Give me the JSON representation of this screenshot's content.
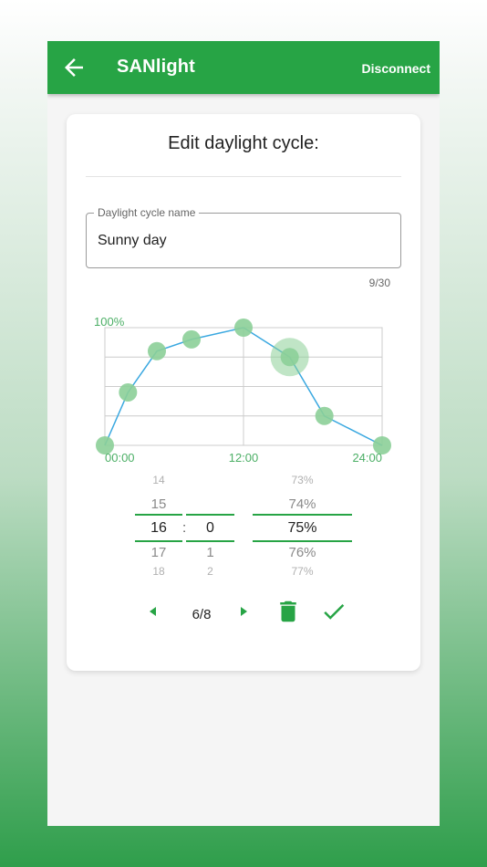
{
  "appbar": {
    "title": "SANlight",
    "disconnect_label": "Disconnect"
  },
  "card": {
    "title": "Edit daylight cycle:",
    "name_field": {
      "label": "Daylight cycle name",
      "value": "Sunny day",
      "counter": "9/30"
    }
  },
  "chart_data": {
    "type": "line",
    "x": [
      0,
      2,
      4.5,
      7.5,
      12,
      16,
      19,
      24
    ],
    "y": [
      0,
      45,
      80,
      90,
      100,
      75,
      25,
      0
    ],
    "xlim": [
      0,
      24
    ],
    "ylim": [
      0,
      100
    ],
    "x_ticks": [
      "00:00",
      "12:00",
      "24:00"
    ],
    "y_label": "100%",
    "selected_index": 5,
    "colors": {
      "line": "#3aa8e0",
      "point": "#8ccf98",
      "label": "#4caf66",
      "grid": "#cccccc"
    }
  },
  "picker": {
    "hours": [
      "14",
      "15",
      "16",
      "17",
      "18"
    ],
    "minutes": [
      "1",
      "2"
    ],
    "minute_selected": "0",
    "separator": ":",
    "percent": [
      "73%",
      "74%",
      "75%",
      "76%",
      "77%"
    ]
  },
  "nav": {
    "page": "6/8"
  },
  "colors": {
    "accent": "#27a445"
  }
}
